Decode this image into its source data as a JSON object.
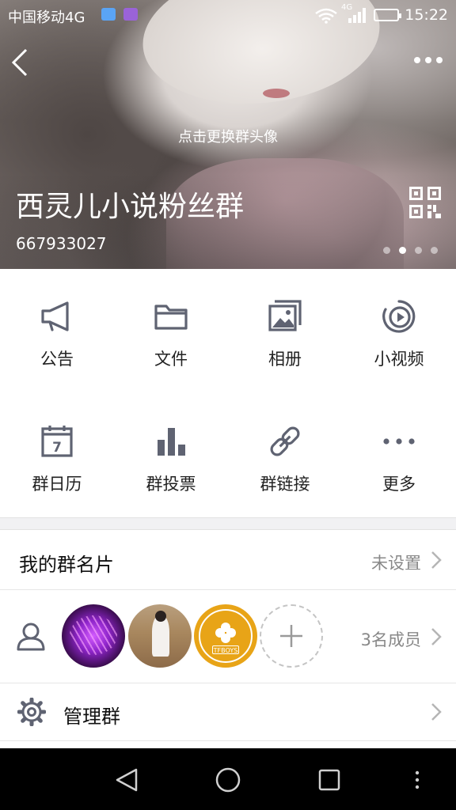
{
  "status_bar": {
    "carrier": "中国移动4G",
    "network": "4G",
    "time": "15:22"
  },
  "header": {
    "change_avatar": "点击更换群头像",
    "group_name": "西灵儿小说粉丝群",
    "group_id": "667933027",
    "page_dots": 4,
    "active_dot": 1
  },
  "features": [
    {
      "label": "公告",
      "icon": "megaphone-icon"
    },
    {
      "label": "文件",
      "icon": "folder-icon"
    },
    {
      "label": "相册",
      "icon": "photo-album-icon"
    },
    {
      "label": "小视频",
      "icon": "video-play-icon"
    },
    {
      "label": "群日历",
      "icon": "calendar-icon",
      "day": "7"
    },
    {
      "label": "群投票",
      "icon": "bar-chart-icon"
    },
    {
      "label": "群链接",
      "icon": "link-icon"
    },
    {
      "label": "更多",
      "icon": "more-dots-icon"
    }
  ],
  "card_row": {
    "label": "我的群名片",
    "value": "未设置"
  },
  "members_row": {
    "count": "3名成员",
    "badge_text": "TFBOYS"
  },
  "manage_row": {
    "label": "管理群"
  },
  "colors": {
    "icon_gray": "#5f6372",
    "text_dark": "#111111",
    "text_secondary": "#888888",
    "chevron": "#b5b5b5",
    "separator": "#f1f1f3"
  }
}
